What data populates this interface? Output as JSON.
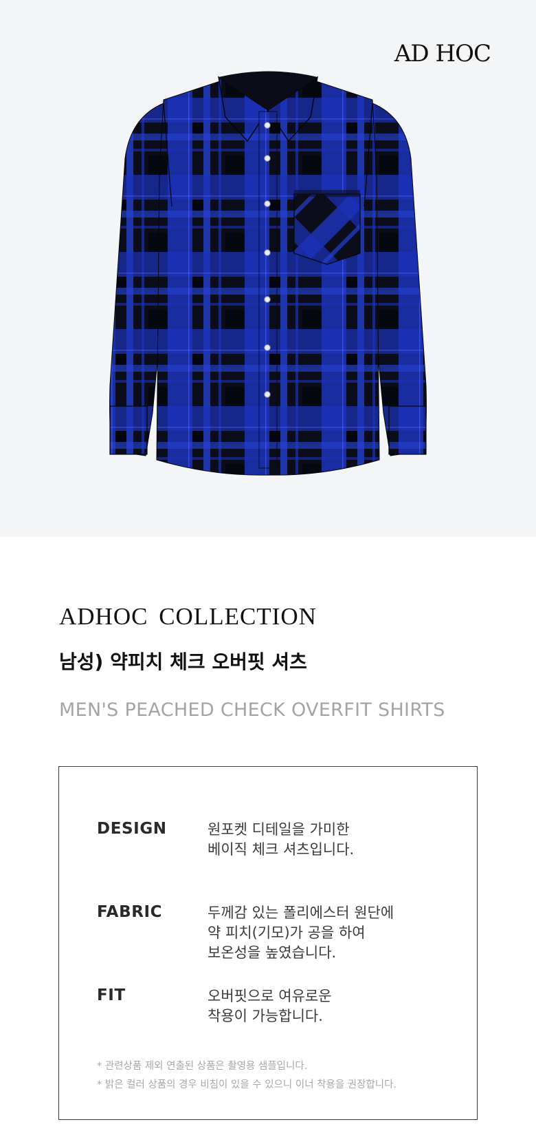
{
  "hero": {
    "brand_logo": "AD HOC",
    "background": "#f4f5f7",
    "product_image": "blue-black-check-shirt"
  },
  "title": {
    "collection": "ADHOC  COLLECTION",
    "name_kr": "남성) 약피치 체크 오버핏 셔츠",
    "name_en": "MEN'S PEACHED CHECK OVERFIT SHIRTS"
  },
  "specs": [
    {
      "label": "DESIGN",
      "lines": [
        "원포켓 디테일을 가미한",
        "베이직 체크 셔츠입니다."
      ]
    },
    {
      "label": "FABRIC",
      "lines": [
        "두께감 있는 폴리에스터 원단에",
        "약 피치(기모)가 공을 하여",
        "보온성을 높였습니다."
      ]
    },
    {
      "label": "FIT",
      "lines": [
        "오버핏으로 여유로운",
        "착용이 가능합니다."
      ]
    }
  ],
  "notes": [
    "* 관련상품 제외 연출된 상품은 촬영용 샘플입니다.",
    "* 밝은 컬러 상품의 경우 비침이 있을 수 있으니 이너 착용을 권장합니다."
  ],
  "colors": {
    "shirt_blue": "#1a2fb0",
    "shirt_black": "#0b0c18",
    "accent_text": "#111111",
    "muted_text": "#a4a4a4"
  }
}
